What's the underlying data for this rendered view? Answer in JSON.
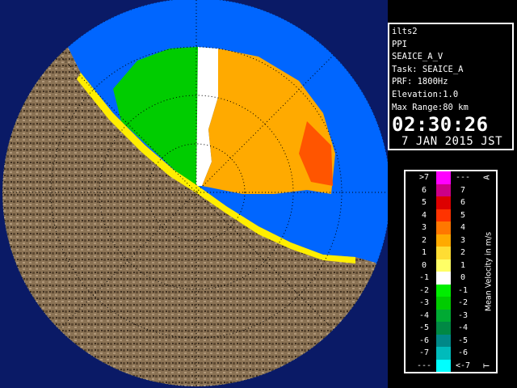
{
  "info": {
    "station": "ilts2",
    "mode": "PPI",
    "product": "SEAICE_A_V",
    "task": "Task: SEAICE_A",
    "prf": "PRF: 1800Hz",
    "elevation": "Elevation:1.0",
    "max_range": "Max Range:80 km",
    "time": "02:30:26",
    "date": "7 JAN 2015 JST"
  },
  "scale": {
    "title": "Mean Velocity in m/s",
    "top_letter": "A",
    "bottom_letter": "T",
    "rows": [
      {
        "left": ">7",
        "right": "---",
        "color": "#ff00ff"
      },
      {
        "left": "6",
        "right": "7",
        "color": "#cc0088"
      },
      {
        "left": "5",
        "right": "6",
        "color": "#dd0000"
      },
      {
        "left": "4",
        "right": "5",
        "color": "#ff3300"
      },
      {
        "left": "3",
        "right": "4",
        "color": "#ff7700"
      },
      {
        "left": "2",
        "right": "3",
        "color": "#ffaa00"
      },
      {
        "left": "1",
        "right": "2",
        "color": "#ffdd33"
      },
      {
        "left": "0",
        "right": "1",
        "color": "#ffff66"
      },
      {
        "left": "-1",
        "right": "0",
        "color": "#ffffff"
      },
      {
        "left": "-2",
        "right": "-1",
        "color": "#00ee00"
      },
      {
        "left": "-3",
        "right": "-2",
        "color": "#00cc00"
      },
      {
        "left": "-4",
        "right": "-3",
        "color": "#00aa33"
      },
      {
        "left": "-5",
        "right": "-4",
        "color": "#008844"
      },
      {
        "left": "-6",
        "right": "-5",
        "color": "#008888"
      },
      {
        "left": "-7",
        "right": "-6",
        "color": "#00bbbb"
      },
      {
        "left": "---",
        "right": "<-7",
        "color": "#00ffff"
      }
    ]
  },
  "colors": {
    "sea": "#0066ff",
    "land": "#8b7355",
    "range_ring_area": "#0a1a66"
  }
}
